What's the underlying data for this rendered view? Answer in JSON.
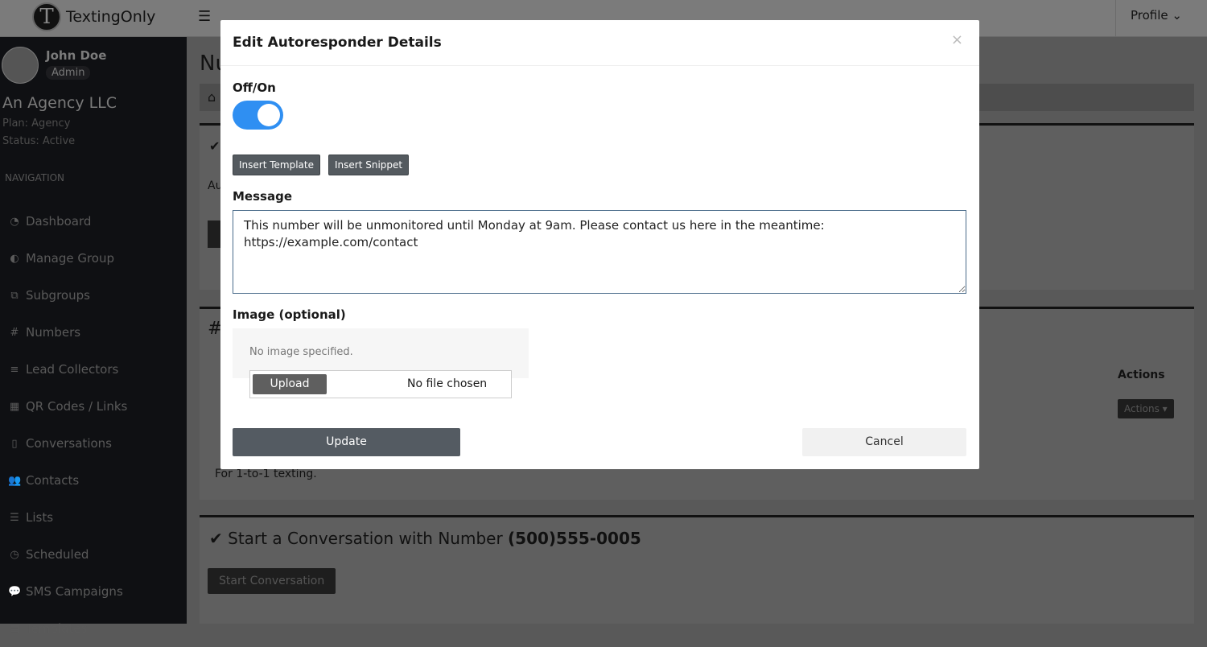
{
  "header": {
    "brand": "TextingOnly",
    "profile": "Profile"
  },
  "user": {
    "name": "John Doe",
    "role": "Admin",
    "agency": "An Agency LLC",
    "plan": "Plan:  Agency",
    "status": "Status:  Active"
  },
  "sidebar": {
    "heading": "NAVIGATION",
    "items": [
      {
        "label": "Dashboard",
        "icon": "dashboard-icon"
      },
      {
        "label": "Manage Group",
        "icon": "half-circle-icon"
      },
      {
        "label": "Subgroups",
        "icon": "sitemap-icon"
      },
      {
        "label": "Numbers",
        "icon": "hash-icon"
      },
      {
        "label": "Lead Collectors",
        "icon": "database-icon"
      },
      {
        "label": "QR Codes / Links",
        "icon": "qrcode-icon"
      },
      {
        "label": "Conversations",
        "icon": "mobile-icon"
      },
      {
        "label": "Contacts",
        "icon": "users-icon"
      },
      {
        "label": "Lists",
        "icon": "list-icon"
      },
      {
        "label": "Scheduled",
        "icon": "clock-icon"
      },
      {
        "label": "SMS Campaigns",
        "icon": "comments-icon"
      },
      {
        "label": "Templates",
        "icon": "file-icon"
      }
    ]
  },
  "page": {
    "title_partial": "Nu",
    "card1_partial": "Au",
    "table_actions_header": "Actions",
    "actions_button": "Actions",
    "number_desc": "For 1-to-1 texting.",
    "start_title": "Start a Conversation with Number",
    "start_number": "(500)555-0005",
    "start_button": "Start Conversation"
  },
  "modal": {
    "title": "Edit Autoresponder Details",
    "close": "×",
    "toggle_label": "Off/On",
    "toggle_on": true,
    "insert_template": "Insert Template",
    "insert_snippet": "Insert Snippet",
    "message_label": "Message",
    "message": "This number will be unmonitored until Monday at 9am. Please contact us here in the meantime:\nhttps://example.com/contact",
    "image_label": "Image (optional)",
    "no_image": "No image specified.",
    "upload": "Upload",
    "no_file": "No file chosen",
    "update": "Update",
    "cancel": "Cancel"
  }
}
